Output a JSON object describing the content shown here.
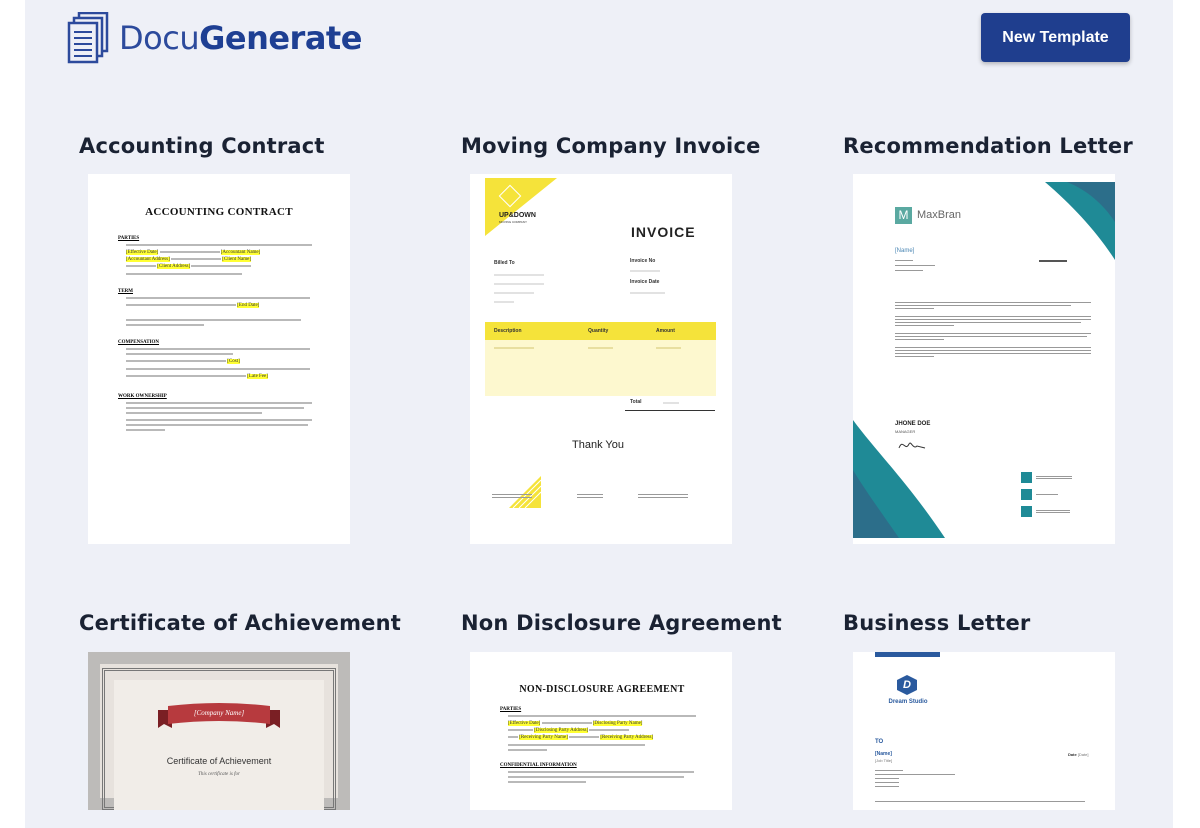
{
  "header": {
    "logo_part1": "Docu",
    "logo_part2": "Generate",
    "new_template_label": "New Template"
  },
  "templates": [
    {
      "title": "Accounting Contract"
    },
    {
      "title": "Moving Company Invoice"
    },
    {
      "title": "Recommendation Letter"
    },
    {
      "title": "Certificate of Achievement"
    },
    {
      "title": "Non Disclosure Agreement"
    },
    {
      "title": "Business Letter"
    }
  ],
  "previews": {
    "accounting": {
      "heading": "ACCOUNTING CONTRACT",
      "parties": "PARTIES",
      "term": "TERM",
      "compensation": "COMPENSATION",
      "work_ownership": "WORK OWNERSHIP",
      "effective_date": "[Effective Date]",
      "accountant_name": "[Accountant Name]",
      "client_name": "[Client Name]",
      "accountant_address": "[Accountant Address]",
      "client_address": "[Client Address]",
      "end_date": "[End Date]",
      "cost": "[Cost]",
      "late_fee": "[Late Fee]"
    },
    "invoice": {
      "company": "UP&DOWN",
      "company_sub": "MOVING COMPANY",
      "title": "INVOICE",
      "billed_to": "Billed To",
      "invoice_no": "Invoice No",
      "invoice_date": "Invoice Date",
      "col_description": "Description",
      "col_quantity": "Quantity",
      "col_amount": "Amount",
      "total": "Total",
      "thank_you": "Thank You"
    },
    "recommendation": {
      "brand_letter": "M",
      "brand": "MaxBran",
      "name": "[Name]",
      "signer": "JHONE DOE",
      "signer_title": "MANAGER"
    },
    "certificate": {
      "company": "[Company Name]",
      "title": "Certificate of Achievement",
      "subtitle": "This certificate is for"
    },
    "nda": {
      "heading": "NON-DISCLOSURE AGREEMENT",
      "parties": "PARTIES",
      "confidential": "CONFIDENTIAL INFORMATION",
      "effective_date": "[Effective Date]",
      "disclosing_party": "[Disclosing Party Name]",
      "disclosing_address": "[Disclosing Party Address]",
      "receiving_party": "[Receiving Party Name]",
      "receiving_address": "[Receiving Party Address]"
    },
    "business": {
      "brand_letter": "D",
      "brand": "Dream Studio",
      "to": "TO",
      "name": "[Name]",
      "job_title": "[Job Title]",
      "date": "Date",
      "date_value": "[Date]"
    }
  },
  "colors": {
    "brand_blue": "#1f3e8e",
    "page_bg": "#eef0f7",
    "invoice_yellow": "#f5e33a",
    "teal": "#1f8a96"
  }
}
